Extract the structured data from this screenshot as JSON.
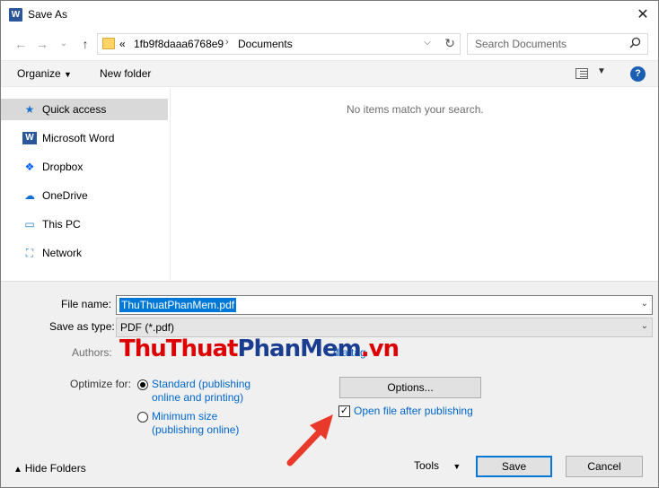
{
  "window": {
    "title": "Save As",
    "app_icon": "W",
    "close_glyph": "✕"
  },
  "navigation": {
    "back_glyph": "←",
    "forward_glyph": "→",
    "recent_glyph": "⌄",
    "up_glyph": "↑"
  },
  "address_bar": {
    "overflow": "«",
    "path": [
      "1fb9f8daaa6768e9",
      "Documents"
    ],
    "separator": "›"
  },
  "search": {
    "placeholder": "Search Documents",
    "icon": "search-icon"
  },
  "toolbar": {
    "organize_label": "Organize",
    "new_folder_label": "New folder",
    "help_glyph": "?"
  },
  "nav_pane": {
    "items": [
      {
        "label": "Quick access",
        "icon": "star-icon",
        "glyph": "★",
        "color": "#1a73c9",
        "selected": true
      },
      {
        "label": "Microsoft Word",
        "icon": "word-icon",
        "glyph": "W",
        "color": "#2b579a",
        "selected": false
      },
      {
        "label": "Dropbox",
        "icon": "dropbox-icon",
        "glyph": "❖",
        "color": "#0061fe",
        "selected": false
      },
      {
        "label": "OneDrive",
        "icon": "cloud-icon",
        "glyph": "☁",
        "color": "#0f6fd6",
        "selected": false
      },
      {
        "label": "This PC",
        "icon": "computer-icon",
        "glyph": "▭",
        "color": "#2d7fc1",
        "selected": false
      },
      {
        "label": "Network",
        "icon": "network-icon",
        "glyph": "⛶",
        "color": "#2d7fc1",
        "selected": false
      }
    ]
  },
  "content": {
    "empty_message": "No items match your search."
  },
  "form": {
    "file_name_label": "File name:",
    "file_name_value": "ThuThuatPhanMem.pdf",
    "save_type_label": "Save as type:",
    "save_type_value": "PDF (*.pdf)",
    "authors_label": "Authors:",
    "tag_link": "d a tag",
    "optimize_label": "Optimize for:",
    "option_standard": "Standard (publishing online and printing)",
    "option_standard_line1": "Standard (publishing",
    "option_standard_line2": "online and printing)",
    "option_minimum_line1": "Minimum size",
    "option_minimum_line2": "(publishing online)",
    "options_button": "Options...",
    "open_after_label": "Open file after publishing",
    "open_after_checked": true
  },
  "footer": {
    "hide_folders_label": "Hide Folders",
    "tools_label": "Tools",
    "save_label": "Save",
    "cancel_label": "Cancel"
  },
  "watermark": {
    "part1": "ThuThuat",
    "part2": "PhanMem",
    "part3": ".vn"
  },
  "annotation": {
    "arrow_color": "#e8392b"
  }
}
